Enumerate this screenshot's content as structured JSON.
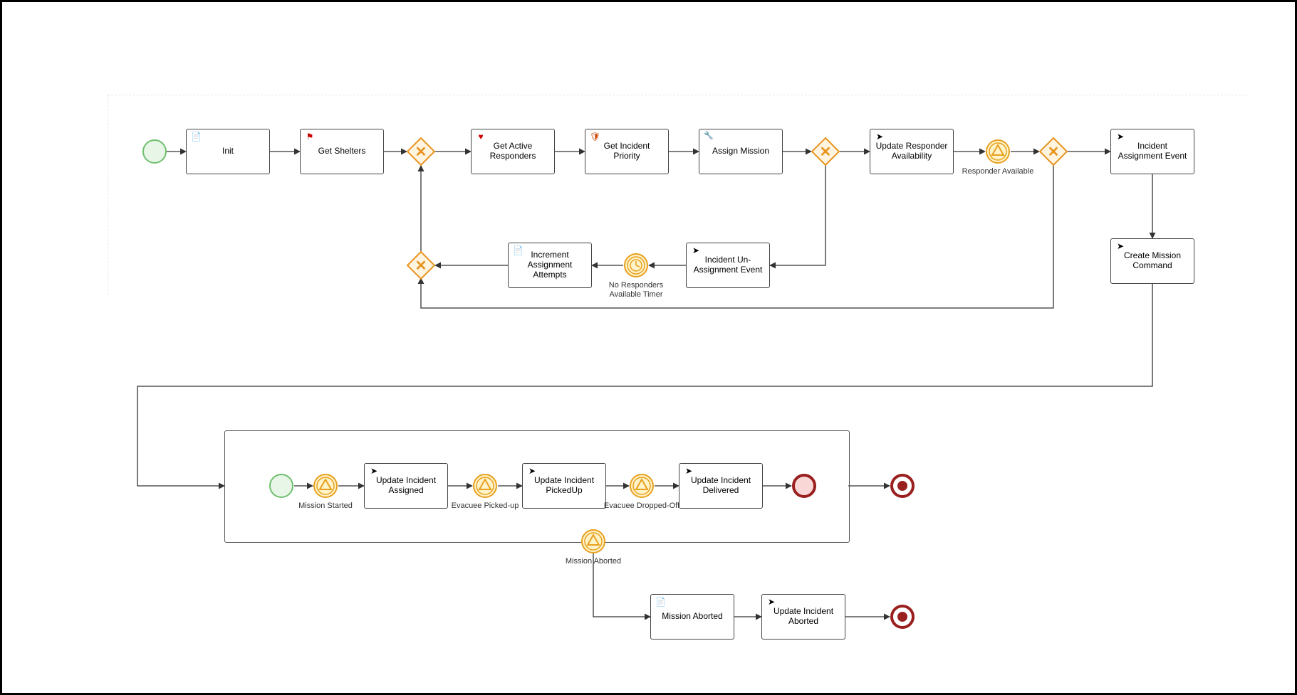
{
  "tasks": {
    "init": "Init",
    "getShelters": "Get Shelters",
    "getActiveResponders": "Get Active Responders",
    "getIncidentPriority": "Get Incident Priority",
    "assignMission": "Assign Mission",
    "updateResponderAvailability": "Update Responder Availability",
    "incidentAssignmentEvent": "Incident Assignment Event",
    "createMissionCommand": "Create Mission Command",
    "incidentUnAssignmentEvent": "Incident Un-Assignment Event",
    "incrementAssignmentAttempts": "Increment Assignment Attempts",
    "updateIncidentAssigned": "Update Incident Assigned",
    "updateIncidentPickedUp": "Update Incident PickedUp",
    "updateIncidentDelivered": "Update Incident Delivered",
    "missionAbortedTask": "Mission Aborted",
    "updateIncidentAborted": "Update Incident Aborted"
  },
  "events": {
    "responderAvailable": "Responder Available",
    "noRespondersAvailableTimer": "No Responders Available Timer",
    "missionStarted": "Mission Started",
    "evacueePickedUp": "Evacuee Picked-up",
    "evacueeDroppedOff": "Evacuee Dropped-Off",
    "missionAborted": "Mission Aborted"
  }
}
